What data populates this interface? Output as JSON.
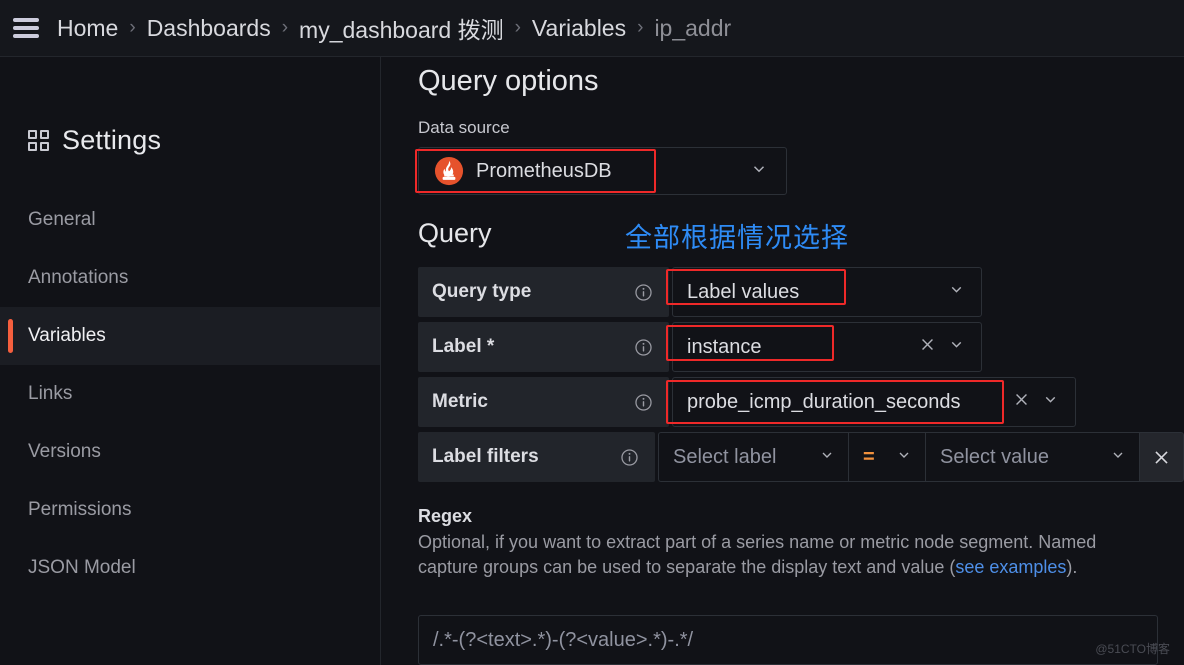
{
  "header": {
    "menu_icon": "hamburger-icon",
    "breadcrumbs": [
      {
        "label": "Home",
        "current": false
      },
      {
        "label": "Dashboards",
        "current": false
      },
      {
        "label": "my_dashboard 拨测",
        "current": false
      },
      {
        "label": "Variables",
        "current": false
      },
      {
        "label": "ip_addr",
        "current": true
      }
    ],
    "separator": "›"
  },
  "sidebar": {
    "title": "Settings",
    "title_icon": "grid-icon",
    "items": [
      {
        "label": "General",
        "active": false
      },
      {
        "label": "Annotations",
        "active": false
      },
      {
        "label": "Variables",
        "active": true
      },
      {
        "label": "Links",
        "active": false
      },
      {
        "label": "Versions",
        "active": false
      },
      {
        "label": "Permissions",
        "active": false
      },
      {
        "label": "JSON Model",
        "active": false
      }
    ],
    "active_accent_color": "#f55f3e"
  },
  "main": {
    "query_options_heading": "Query options",
    "data_source": {
      "label": "Data source",
      "value": "PrometheusDB",
      "icon": "prometheus-icon",
      "caret": "chevron-down-icon"
    },
    "query_heading": "Query",
    "annotation_note": {
      "text": "全部根据情况选择",
      "color": "#2e8bf5"
    },
    "rows": [
      {
        "label": "Query type",
        "info_icon": "info-circle-icon",
        "value": "Label values",
        "is_placeholder": false,
        "has_clear": false,
        "caret": "chevron-down-icon",
        "highlighted": true
      },
      {
        "label": "Label *",
        "info_icon": "info-circle-icon",
        "value": "instance",
        "is_placeholder": false,
        "has_clear": true,
        "clear_icon": "close-icon",
        "caret": "chevron-down-icon",
        "highlighted": true
      },
      {
        "label": "Metric",
        "info_icon": "info-circle-icon",
        "value": "probe_icmp_duration_seconds",
        "is_placeholder": false,
        "has_clear": true,
        "clear_icon": "close-icon",
        "caret": "chevron-down-icon",
        "highlighted": true
      }
    ],
    "label_filters": {
      "label": "Label filters",
      "info_icon": "info-circle-icon",
      "select_label_placeholder": "Select label",
      "operator": "=",
      "operator_color": "#f2913d",
      "select_value_placeholder": "Select value",
      "remove_icon": "close-icon"
    },
    "regex": {
      "title": "Regex",
      "description_part1": "Optional, if you want to extract part of a series name or metric node segment. Named capture groups can be used to separate the display text and value (",
      "link_text": "see examples",
      "description_part2": ").",
      "placeholder": "/.*-(?<text>.*)-(?<value>.*)-.*/"
    }
  },
  "watermark": "@51CTO博客"
}
